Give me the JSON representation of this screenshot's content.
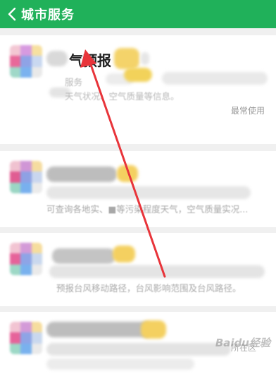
{
  "header": {
    "title": "城市服务",
    "back_icon": "chevron-left-icon",
    "background": "#20b15a"
  },
  "services": [
    {
      "name": "气预报",
      "subtitle": "服务",
      "description": "天气状况、空气质量等信息。",
      "tag": "最常使用"
    },
    {
      "description": "可查询各地实、■等污染程度天气，空气质量实况..."
    },
    {
      "description": "预报台风移动路径，台风影响范围及台风路径。"
    },
    {
      "extra": "所在区"
    }
  ],
  "watermark": {
    "text": "Baidu经验"
  },
  "annotation": {
    "arrow_color": "#e8343a"
  }
}
